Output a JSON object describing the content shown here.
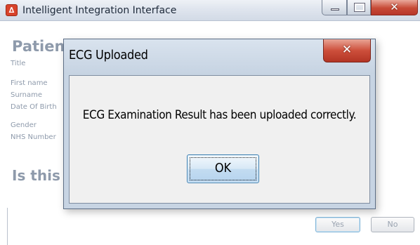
{
  "window": {
    "title": "Intelligent Integration Interface",
    "icon": "app-icon"
  },
  "patient_details": {
    "heading": "Patient Details",
    "fields": [
      {
        "label": "Title"
      },
      {
        "label": "First name"
      },
      {
        "label": "Surname"
      },
      {
        "label": "Date Of Birth"
      },
      {
        "label": "Gender"
      },
      {
        "label": "NHS Number"
      }
    ],
    "question": "Is this"
  },
  "footer": {
    "yes_label": "Yes",
    "no_label": "No"
  },
  "dialog": {
    "title": "ECG Uploaded",
    "message": "ECG Examination Result has been uploaded correctly.",
    "ok_label": "OK"
  },
  "colors": {
    "titlebar": "#dfe5ee",
    "close_button": "#c74a36",
    "dialog_frame": "#c7d4e3",
    "muted_text": "#8e9aab",
    "ok_border": "#3c7fb1"
  }
}
